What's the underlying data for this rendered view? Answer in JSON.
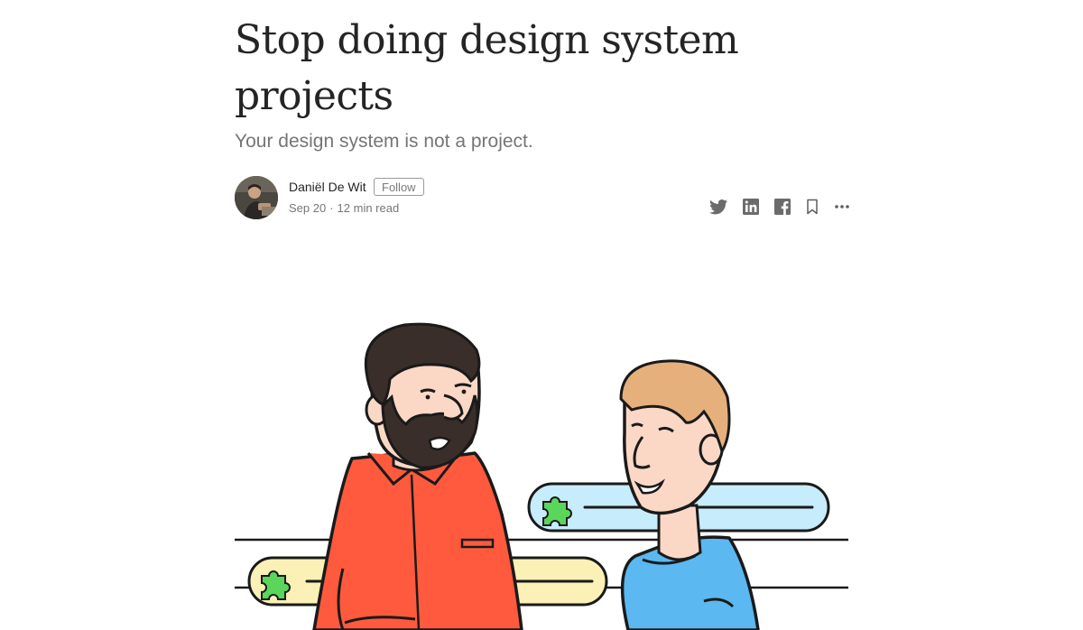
{
  "article": {
    "title": "Stop doing design system projects",
    "subtitle": "Your design system is not a project."
  },
  "author": {
    "name": "Daniël De Wit",
    "follow_label": "Follow",
    "date": "Sep 20",
    "separator": "·",
    "read_time": "12 min read"
  },
  "share_actions": [
    {
      "icon": "twitter-icon"
    },
    {
      "icon": "linkedin-icon"
    },
    {
      "icon": "facebook-icon"
    },
    {
      "icon": "bookmark-icon"
    },
    {
      "icon": "more-icon"
    }
  ],
  "colors": {
    "text": "#242424",
    "muted": "#757575",
    "red_shirt": "#ff5a3d",
    "blue_shirt": "#5bb8f0",
    "pill_blue": "#c7ecfb",
    "pill_yellow": "#fbf0b6",
    "puzzle_green": "#5ad65a",
    "skin": "#fbd8c6",
    "blond_hair": "#e6b07c",
    "dark_hair": "#3a2e2a"
  }
}
